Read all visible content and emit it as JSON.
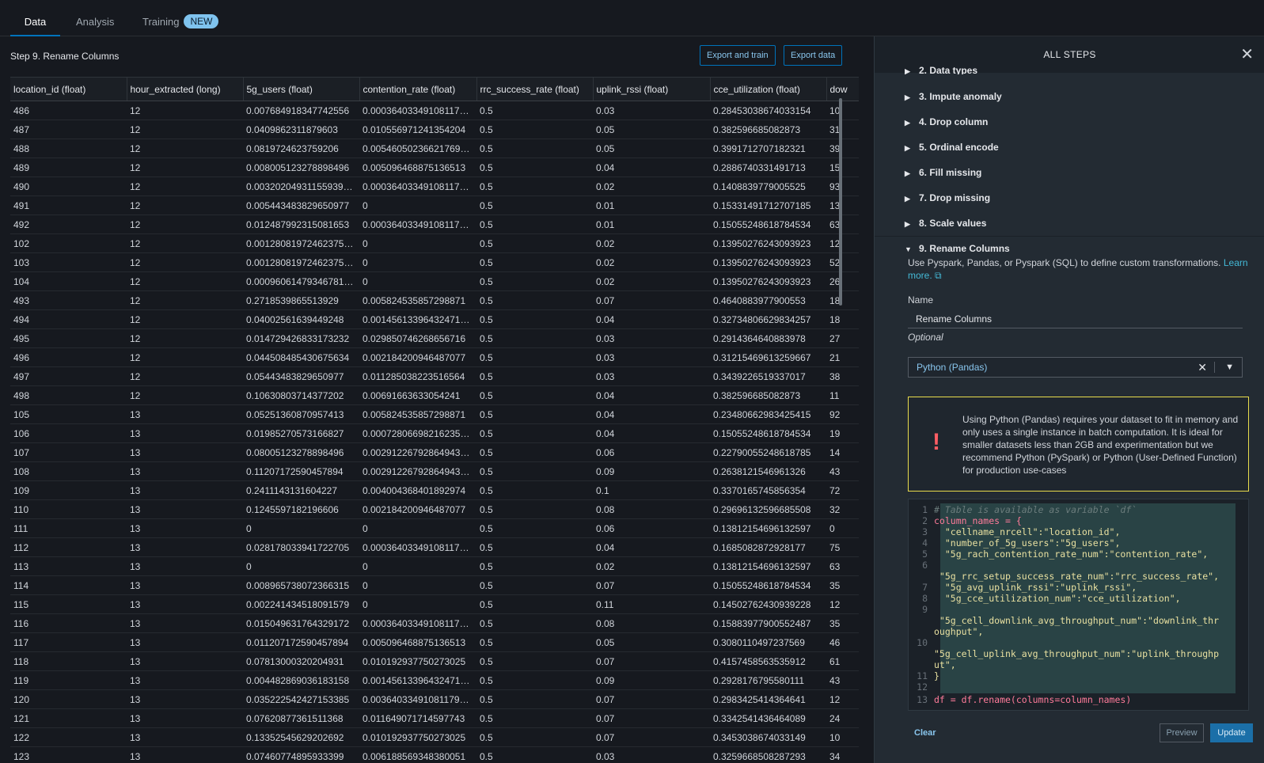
{
  "tabs": [
    {
      "label": "Data"
    },
    {
      "label": "Analysis"
    },
    {
      "label": "Training",
      "badge": "NEW"
    }
  ],
  "main": {
    "step_title": "Step 9. Rename Columns",
    "export_train_label": "Export and train",
    "export_data_label": "Export data"
  },
  "table": {
    "columns": [
      "location_id (float)",
      "hour_extracted (long)",
      "5g_users (float)",
      "contention_rate (float)",
      "rrc_success_rate (float)",
      "uplink_rssi (float)",
      "cce_utilization (float)",
      "dow"
    ],
    "rows": [
      [
        "486",
        "12",
        "0.007684918347742556",
        "0.00036403349108117…",
        "0.5",
        "0.03",
        "0.28453038674033154",
        "10"
      ],
      [
        "487",
        "12",
        "0.0409862311879603",
        "0.010556971241354204",
        "0.5",
        "0.05",
        "0.382596685082873",
        "31"
      ],
      [
        "488",
        "12",
        "0.0819724623759206",
        "0.00546050236621769…",
        "0.5",
        "0.05",
        "0.3991712707182321",
        "39"
      ],
      [
        "489",
        "12",
        "0.008005123278898496",
        "0.005096468875136513",
        "0.5",
        "0.04",
        "0.2886740331491713",
        "15"
      ],
      [
        "490",
        "12",
        "0.00320204931155939…",
        "0.00036403349108117…",
        "0.5",
        "0.02",
        "0.1408839779005525",
        "93"
      ],
      [
        "491",
        "12",
        "0.005443483829650977",
        "0",
        "0.5",
        "0.01",
        "0.15331491712707185",
        "13"
      ],
      [
        "492",
        "12",
        "0.012487992315081653",
        "0.00036403349108117…",
        "0.5",
        "0.01",
        "0.15055248618784534",
        "63"
      ],
      [
        "102",
        "12",
        "0.00128081972462375…",
        "0",
        "0.5",
        "0.02",
        "0.13950276243093923",
        "12"
      ],
      [
        "103",
        "12",
        "0.00128081972462375…",
        "0",
        "0.5",
        "0.02",
        "0.13950276243093923",
        "52"
      ],
      [
        "104",
        "12",
        "0.00096061479346781…",
        "0",
        "0.5",
        "0.02",
        "0.13950276243093923",
        "26"
      ],
      [
        "493",
        "12",
        "0.2718539865513929",
        "0.005824535857298871",
        "0.5",
        "0.07",
        "0.4640883977900553",
        "18"
      ],
      [
        "494",
        "12",
        "0.04002561639449248",
        "0.00145613396432471…",
        "0.5",
        "0.04",
        "0.32734806629834257",
        "18"
      ],
      [
        "495",
        "12",
        "0.014729426833173232",
        "0.029850746268656716",
        "0.5",
        "0.03",
        "0.2914364640883978",
        "27"
      ],
      [
        "496",
        "12",
        "0.044508485430675634",
        "0.002184200946487077",
        "0.5",
        "0.03",
        "0.31215469613259667",
        "21"
      ],
      [
        "497",
        "12",
        "0.05443483829650977",
        "0.011285038223516564",
        "0.5",
        "0.03",
        "0.3439226519337017",
        "38"
      ],
      [
        "498",
        "12",
        "0.10630803714377202",
        "0.00691663633054241",
        "0.5",
        "0.04",
        "0.382596685082873",
        "11"
      ],
      [
        "105",
        "13",
        "0.05251360870957413",
        "0.005824535857298871",
        "0.5",
        "0.04",
        "0.23480662983425415",
        "92"
      ],
      [
        "106",
        "13",
        "0.01985270573166827",
        "0.00072806698216235…",
        "0.5",
        "0.04",
        "0.15055248618784534",
        "19"
      ],
      [
        "107",
        "13",
        "0.08005123278898496",
        "0.00291226792864943…",
        "0.5",
        "0.06",
        "0.22790055248618785",
        "14"
      ],
      [
        "108",
        "13",
        "0.11207172590457894",
        "0.00291226792864943…",
        "0.5",
        "0.09",
        "0.2638121546961326",
        "43"
      ],
      [
        "109",
        "13",
        "0.2411143131604227",
        "0.004004368401892974",
        "0.5",
        "0.1",
        "0.3370165745856354",
        "72"
      ],
      [
        "110",
        "13",
        "0.1245597182196606",
        "0.002184200946487077",
        "0.5",
        "0.08",
        "0.29696132596685508",
        "32"
      ],
      [
        "111",
        "13",
        "0",
        "0",
        "0.5",
        "0.06",
        "0.13812154696132597",
        "0"
      ],
      [
        "112",
        "13",
        "0.028178033941722705",
        "0.00036403349108117…",
        "0.5",
        "0.04",
        "0.1685082872928177",
        "75"
      ],
      [
        "113",
        "13",
        "0",
        "0",
        "0.5",
        "0.02",
        "0.13812154696132597",
        "63"
      ],
      [
        "114",
        "13",
        "0.008965738072366315",
        "0",
        "0.5",
        "0.07",
        "0.15055248618784534",
        "35"
      ],
      [
        "115",
        "13",
        "0.002241434518091579",
        "0",
        "0.5",
        "0.11",
        "0.14502762430939228",
        "12"
      ],
      [
        "116",
        "13",
        "0.015049631764329172",
        "0.00036403349108117…",
        "0.5",
        "0.08",
        "0.15883977900552487",
        "35"
      ],
      [
        "117",
        "13",
        "0.011207172590457894",
        "0.005096468875136513",
        "0.5",
        "0.05",
        "0.3080110497237569",
        "46"
      ],
      [
        "118",
        "13",
        "0.07813000320204931",
        "0.010192937750273025",
        "0.5",
        "0.07",
        "0.4157458563535912",
        "61"
      ],
      [
        "119",
        "13",
        "0.004482869036183158",
        "0.00145613396432471…",
        "0.5",
        "0.09",
        "0.2928176795580111",
        "43"
      ],
      [
        "120",
        "13",
        "0.035222542427153385",
        "0.00364033491081179…",
        "0.5",
        "0.07",
        "0.2983425414364641",
        "12"
      ],
      [
        "121",
        "13",
        "0.07620877361511368",
        "0.011649071714597743",
        "0.5",
        "0.07",
        "0.3342541436464089",
        "24"
      ],
      [
        "122",
        "13",
        "0.13352545629202692",
        "0.010192937750273025",
        "0.5",
        "0.07",
        "0.3453038674033149",
        "10"
      ],
      [
        "123",
        "13",
        "0.07460774895933399",
        "0.006188569348380051",
        "0.5",
        "0.03",
        "0.3259668508287293",
        "34"
      ]
    ]
  },
  "panel": {
    "title": "ALL STEPS",
    "steps": [
      {
        "label": "2. Data types"
      },
      {
        "label": "3. Impute anomaly"
      },
      {
        "label": "4. Drop column"
      },
      {
        "label": "5. Ordinal encode"
      },
      {
        "label": "6. Fill missing"
      },
      {
        "label": "7. Drop missing"
      },
      {
        "label": "8. Scale values"
      },
      {
        "label": "9. Rename Columns"
      }
    ],
    "description": "Use Pyspark, Pandas, or Pyspark (SQL) to define custom transformations.",
    "learn_more": "Learn more.",
    "name_label": "Name",
    "name_value": "Rename Columns",
    "optional_label": "Optional",
    "select_value": "Python (Pandas)",
    "warning": "Using Python (Pandas) requires your dataset to fit in memory and only uses a single instance in batch computation. It is ideal for smaller datasets less than 2GB and experimentation but we recommend Python (PySpark) or Python (User-Defined Function) for production use-cases",
    "code_lines": [
      {
        "n": "1",
        "t": "# Table is available as variable `df`"
      },
      {
        "n": "2",
        "t": "column_names = {"
      },
      {
        "n": "3",
        "t": "  \"cellname_nrcell\":\"location_id\","
      },
      {
        "n": "4",
        "t": "  \"number_of_5g_users\":\"5g_users\","
      },
      {
        "n": "5",
        "t": "  \"5g_rach_contention_rate_num\":\"contention_rate\","
      },
      {
        "n": "6",
        "t": ""
      },
      {
        "n": "",
        "t": " \"5g_rrc_setup_success_rate_num\":\"rrc_success_rate\","
      },
      {
        "n": "7",
        "t": "  \"5g_avg_uplink_rssi\":\"uplink_rssi\","
      },
      {
        "n": "8",
        "t": "  \"5g_cce_utilization_num\":\"cce_utilization\","
      },
      {
        "n": "9",
        "t": ""
      },
      {
        "n": "",
        "t": " \"5g_cell_downlink_avg_throughput_num\":\"downlink_thr"
      },
      {
        "n": "",
        "t": "oughput\","
      },
      {
        "n": "10",
        "t": ""
      },
      {
        "n": "",
        "t": "\"5g_cell_uplink_avg_throughput_num\":\"uplink_throughp"
      },
      {
        "n": "",
        "t": "ut\","
      },
      {
        "n": "11",
        "t": "}"
      },
      {
        "n": "12",
        "t": ""
      },
      {
        "n": "13",
        "t": "df = df.rename(columns=column_names)"
      }
    ],
    "clear_label": "Clear",
    "preview_label": "Preview",
    "update_label": "Update"
  }
}
